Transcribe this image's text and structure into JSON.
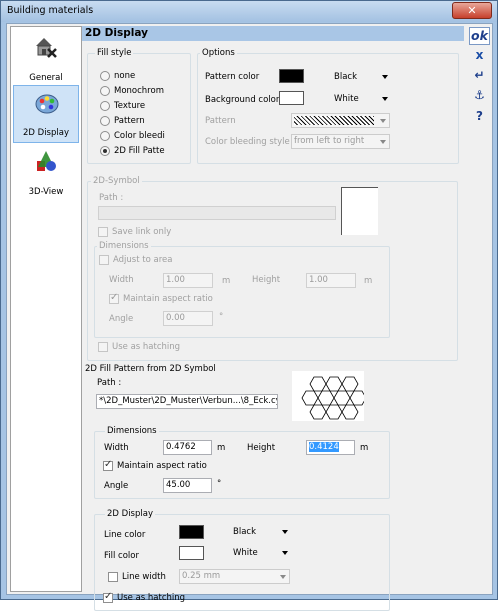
{
  "window": {
    "title": "Building materials",
    "close": "✕"
  },
  "nav": [
    {
      "label": "General",
      "icon": "house-tools-icon"
    },
    {
      "label": "2D Display",
      "icon": "palette-icon"
    },
    {
      "label": "3D-View",
      "icon": "shapes-3d-icon"
    }
  ],
  "header": {
    "title": "2D Display"
  },
  "tools": {
    "ok": "ok",
    "cancel": "x",
    "enter": "↵",
    "anchor": "⚓",
    "help": "?"
  },
  "fill_style": {
    "legend": "Fill style",
    "options": [
      "none",
      "Monochrom",
      "Texture",
      "Pattern",
      "Color bleedi",
      "2D Fill Patte"
    ],
    "selected": "2D Fill Patte"
  },
  "options": {
    "legend": "Options",
    "pattern_color_label": "Pattern color",
    "pattern_color_value": "Black",
    "pattern_color_hex": "#000000",
    "background_color_label": "Background color",
    "background_color_value": "White",
    "background_color_hex": "#ffffff",
    "pattern_label": "Pattern",
    "color_bleeding_label": "Color bleeding style",
    "color_bleeding_value": "from left to right"
  },
  "symbol2d": {
    "legend": "2D-Symbol",
    "path_label": "Path :",
    "save_link_label": "Save link only",
    "dimensions_legend": "Dimensions",
    "adjust_label": "Adjust to area",
    "width_label": "Width",
    "width_value": "1.00",
    "width_unit": "m",
    "height_label": "Height",
    "height_value": "1.00",
    "height_unit": "m",
    "maintain_label": "Maintain aspect ratio",
    "angle_label": "Angle",
    "angle_value": "0.00",
    "angle_unit": "°",
    "hatching_label": "Use as hatching"
  },
  "fill_pattern": {
    "legend": "2D Fill Pattern from 2D Symbol",
    "path_label": "Path :",
    "path_value": "*\\2D_Muster\\2D_Muster\\Verbun...\\8_Eck.cys",
    "dimensions_legend": "Dimensions",
    "width_label": "Width",
    "width_value": "0.4762",
    "width_unit": "m",
    "height_label": "Height",
    "height_value": "0.4124",
    "height_unit": "m",
    "maintain_label": "Maintain aspect ratio",
    "angle_label": "Angle",
    "angle_value": "45.00",
    "angle_unit": "°"
  },
  "display2d": {
    "legend": "2D Display",
    "line_color_label": "Line color",
    "line_color_value": "Black",
    "line_color_hex": "#000000",
    "fill_color_label": "Fill color",
    "fill_color_value": "White",
    "fill_color_hex": "#ffffff",
    "line_width_label": "Line width",
    "line_width_value": "0.25 mm",
    "hatching_label": "Use as hatching"
  }
}
